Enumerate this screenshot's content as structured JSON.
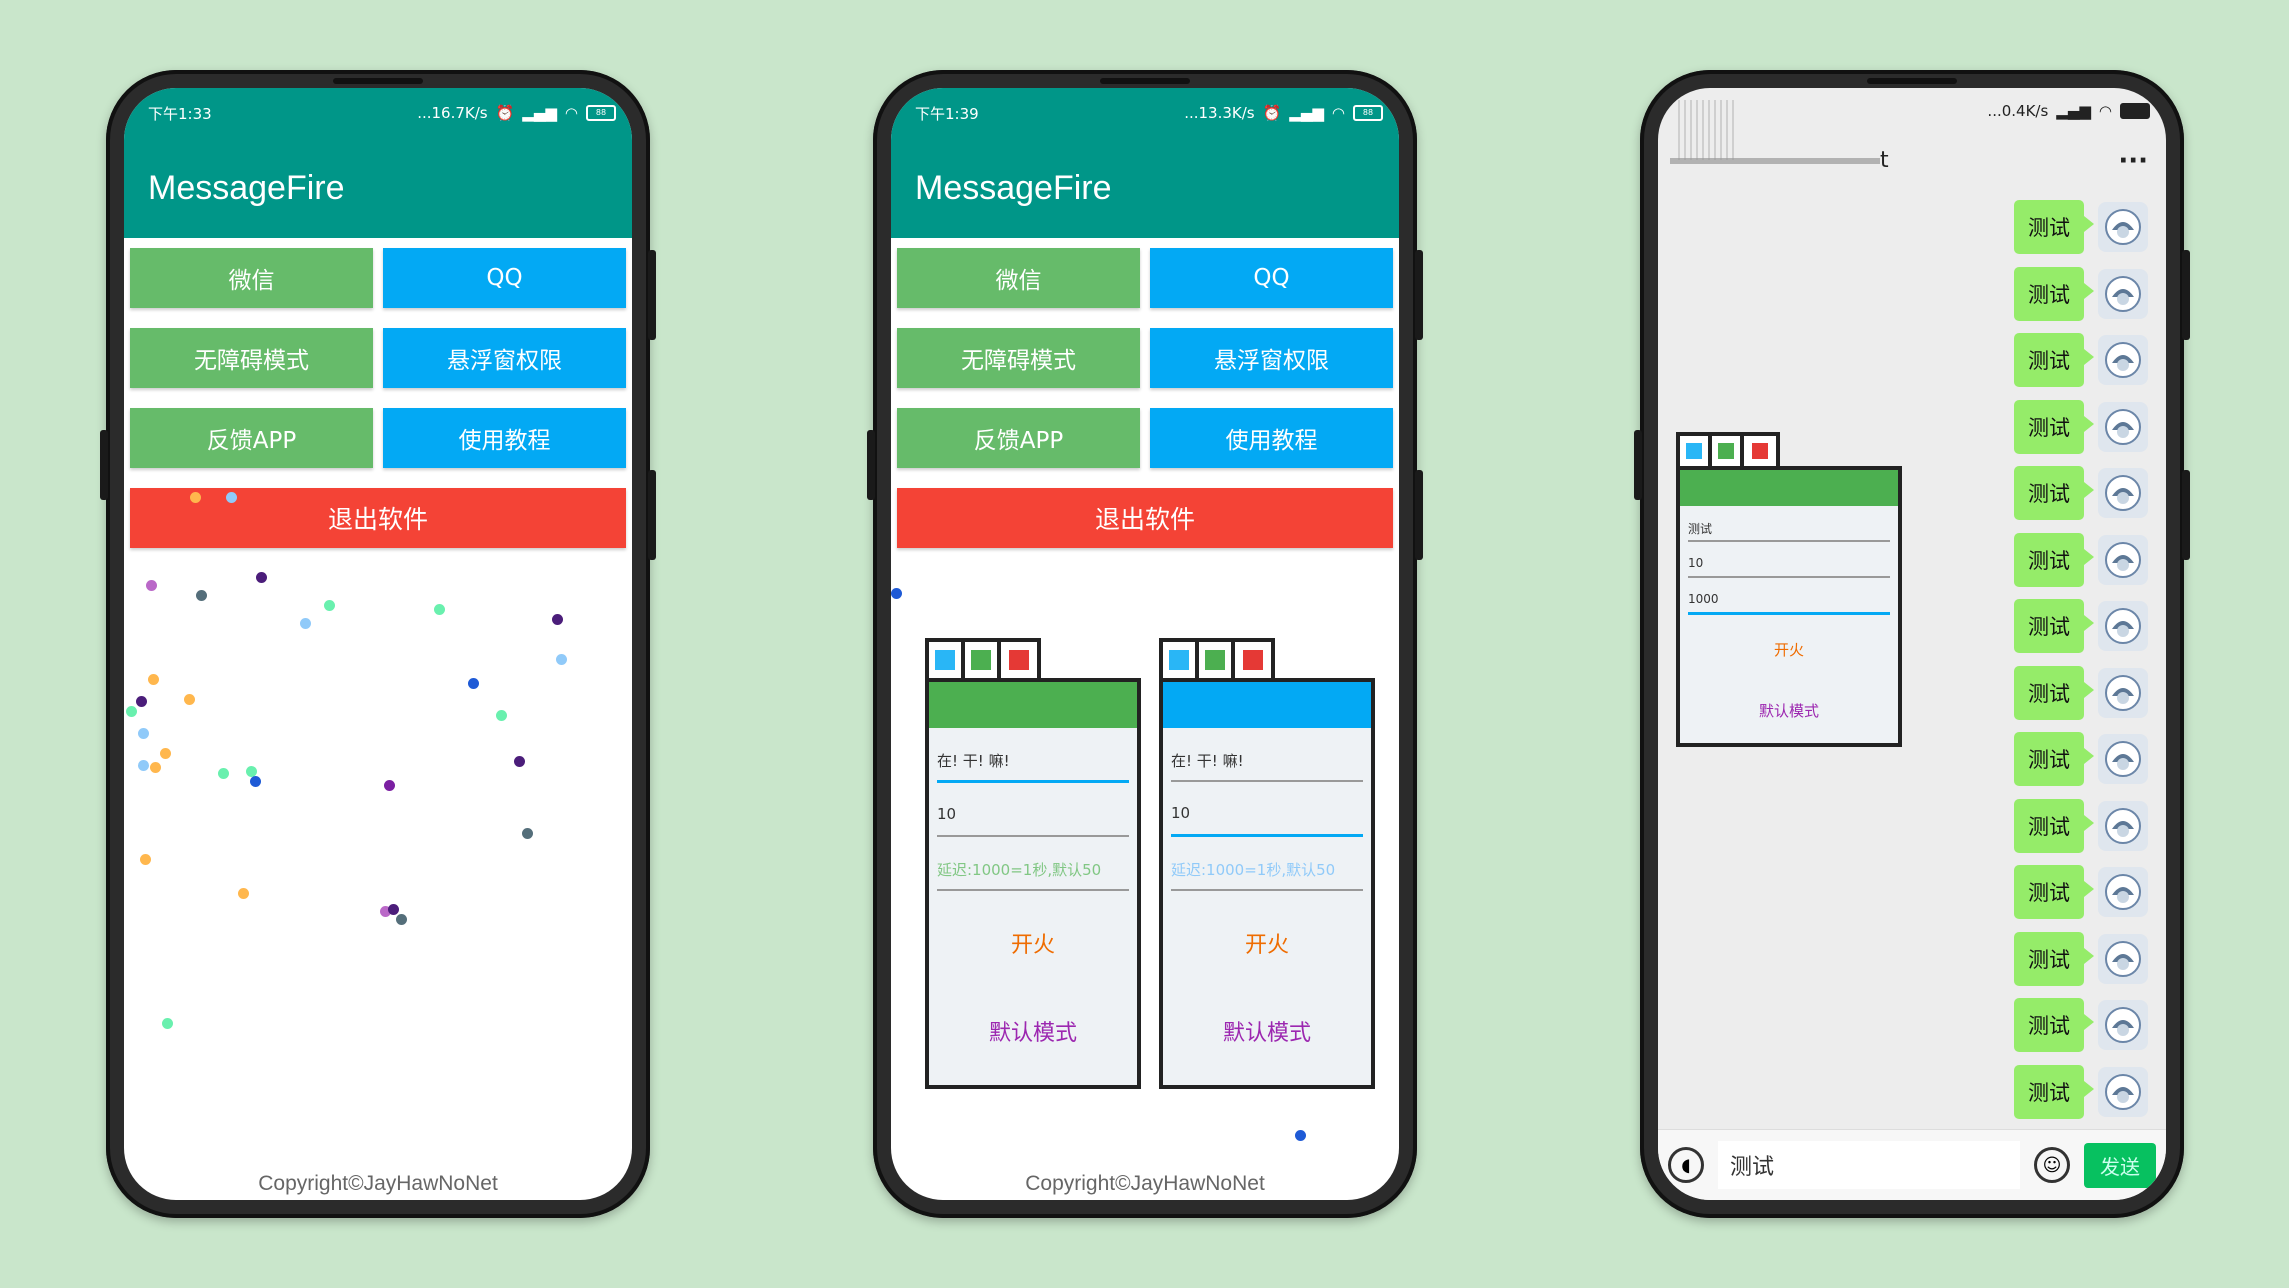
{
  "app": {
    "title": "MessageFire",
    "buttons": {
      "wechat": "微信",
      "qq": "QQ",
      "accessibility": "无障碍模式",
      "overlay_permission": "悬浮窗权限",
      "feedback": "反馈APP",
      "tutorial": "使用教程",
      "exit": "退出软件"
    },
    "copyright": "Copyright©JayHawNoNet"
  },
  "phone1": {
    "status_time": "下午1:33",
    "status_speed": "...16.7K/s",
    "battery": "88"
  },
  "phone2": {
    "status_time": "下午1:39",
    "status_speed": "...13.3K/s",
    "battery": "88",
    "widgets": [
      {
        "header_color": "#4caf50",
        "message": "在! 干! 嘛!",
        "count": "10",
        "delay_hint": "延迟:1000=1秒,默认50",
        "fire": "开火",
        "mode": "默认模式"
      },
      {
        "header_color": "#03a9f4",
        "message": "在! 干! 嘛!",
        "count": "10",
        "delay_hint": "延迟:1000=1秒,默认50",
        "fire": "开火",
        "mode": "默认模式"
      }
    ]
  },
  "phone3": {
    "status_speed": "...0.4K/s",
    "chat_title_suffix": "t",
    "more": "···",
    "message_text": "测试",
    "message_count": 14,
    "widget": {
      "header_color": "#4caf50",
      "message": "测试",
      "count": "10",
      "delay": "1000",
      "fire": "开火",
      "mode": "默认模式"
    },
    "input_text": "测试",
    "send_label": "发送"
  },
  "colors": {
    "background": "#c9e6cb",
    "teal": "#009688",
    "green": "#66bb6a",
    "blue": "#03a9f4",
    "red": "#f44336",
    "wechat_bubble": "#95ec69"
  }
}
